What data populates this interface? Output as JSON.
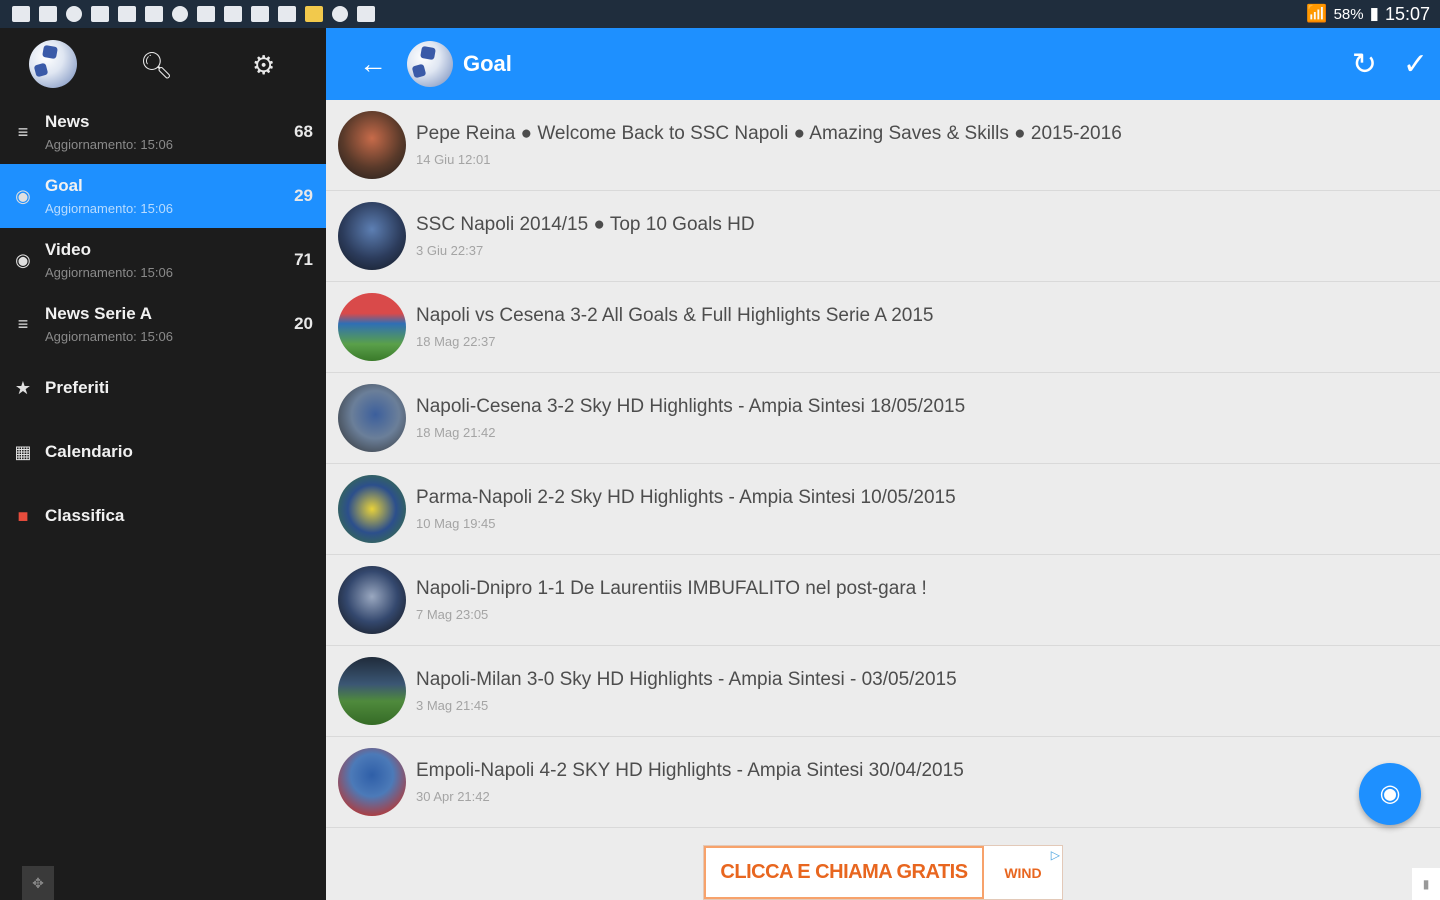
{
  "statusbar": {
    "battery": "58%",
    "time": "15:07"
  },
  "sidebar": {
    "items": [
      {
        "icon": "rss-icon",
        "title": "News",
        "subtitle": "Aggiornamento: 15:06",
        "count": "68"
      },
      {
        "icon": "play-circle-icon",
        "title": "Goal",
        "subtitle": "Aggiornamento: 15:06",
        "count": "29"
      },
      {
        "icon": "play-circle-icon",
        "title": "Video",
        "subtitle": "Aggiornamento: 15:06",
        "count": "71"
      },
      {
        "icon": "rss-icon",
        "title": "News Serie A",
        "subtitle": "Aggiornamento: 15:06",
        "count": "20"
      },
      {
        "icon": "star-icon",
        "title": "Preferiti"
      },
      {
        "icon": "calendar-icon",
        "title": "Calendario"
      },
      {
        "icon": "italy-flag-icon",
        "title": "Classifica"
      }
    ]
  },
  "header": {
    "title": "Goal"
  },
  "list": [
    {
      "title": "Pepe Reina ● Welcome Back to SSC Napoli ● Amazing Saves & Skills ● 2015-2016",
      "date": "14 Giu 12:01"
    },
    {
      "title": "SSC Napoli 2014/15 ● Top 10 Goals HD",
      "date": "3 Giu 22:37"
    },
    {
      "title": "Napoli vs Cesena 3-2 All Goals & Full Highlights Serie A 2015",
      "date": "18 Mag 22:37"
    },
    {
      "title": "Napoli-Cesena 3-2 Sky HD Highlights - Ampia Sintesi 18/05/2015",
      "date": "18 Mag 21:42"
    },
    {
      "title": "Parma-Napoli 2-2 Sky HD Highlights - Ampia Sintesi 10/05/2015",
      "date": "10 Mag 19:45"
    },
    {
      "title": "Napoli-Dnipro 1-1 De Laurentiis IMBUFALITO nel post-gara !",
      "date": "7 Mag 23:05"
    },
    {
      "title": "Napoli-Milan 3-0 Sky HD Highlights - Ampia Sintesi - 03/05/2015",
      "date": "3 Mag 21:45"
    },
    {
      "title": "Empoli-Napoli 4-2 SKY HD Highlights - Ampia Sintesi 30/04/2015",
      "date": "30 Apr 21:42"
    }
  ],
  "ad": {
    "left_text": "CLICCA E CHIAMA GRATIS",
    "right_text": "WIND"
  }
}
